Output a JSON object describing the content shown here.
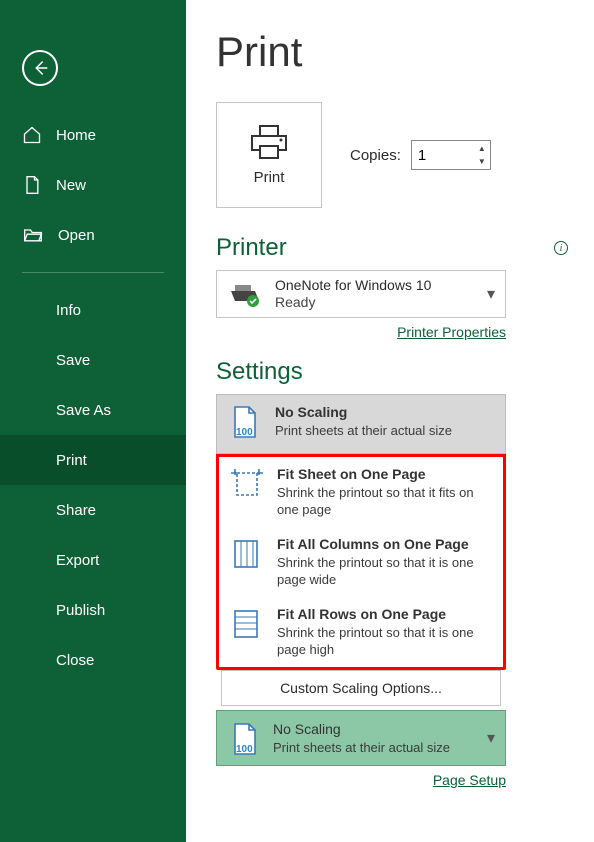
{
  "sidebar": {
    "primary": [
      {
        "label": "Home",
        "icon": "home-icon"
      },
      {
        "label": "New",
        "icon": "new-icon"
      },
      {
        "label": "Open",
        "icon": "open-icon"
      }
    ],
    "secondary": [
      {
        "label": "Info"
      },
      {
        "label": "Save"
      },
      {
        "label": "Save As"
      },
      {
        "label": "Print",
        "active": true
      },
      {
        "label": "Share"
      },
      {
        "label": "Export"
      },
      {
        "label": "Publish"
      },
      {
        "label": "Close"
      }
    ]
  },
  "main": {
    "title": "Print",
    "print_button": "Print",
    "copies_label": "Copies:",
    "copies_value": "1",
    "printer_header": "Printer",
    "printer": {
      "name": "OneNote for Windows 10",
      "status": "Ready"
    },
    "printer_properties": "Printer Properties",
    "settings_header": "Settings",
    "scaling_options": [
      {
        "title": "No Scaling",
        "desc": "Print sheets at their actual size",
        "selected": true,
        "badge": "100"
      },
      {
        "title": "Fit Sheet on One Page",
        "desc": "Shrink the printout so that it fits on one page"
      },
      {
        "title": "Fit All Columns on One Page",
        "desc": "Shrink the printout so that it is one page wide"
      },
      {
        "title": "Fit All Rows on One Page",
        "desc": "Shrink the printout so that it is one page high"
      }
    ],
    "custom_scaling": "Custom Scaling Options...",
    "current_scaling": {
      "title": "No Scaling",
      "desc": "Print sheets at their actual size",
      "badge": "100"
    },
    "page_setup": "Page Setup"
  },
  "colors": {
    "brand": "#0e6137",
    "highlight": "#ff0000",
    "select_bg": "#8cc8a6"
  }
}
